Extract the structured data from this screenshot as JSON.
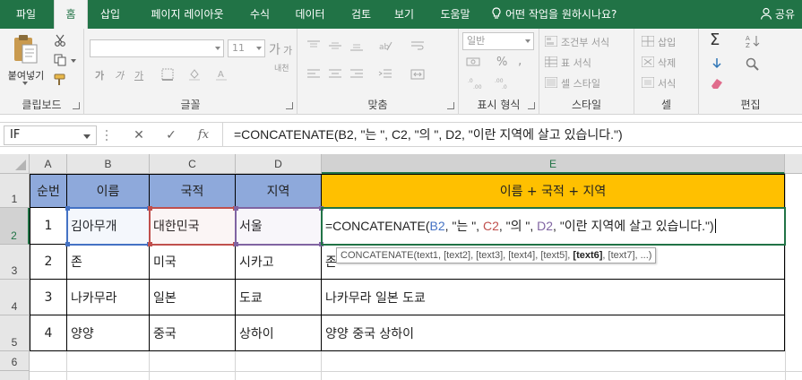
{
  "ribbon_tabs": [
    {
      "label": "파일",
      "active": false
    },
    {
      "label": "홈",
      "active": true
    },
    {
      "label": "삽입",
      "active": false
    },
    {
      "label": "페이지 레이아웃",
      "active": false
    },
    {
      "label": "수식",
      "active": false
    },
    {
      "label": "데이터",
      "active": false
    },
    {
      "label": "검토",
      "active": false
    },
    {
      "label": "보기",
      "active": false
    },
    {
      "label": "도움말",
      "active": false
    }
  ],
  "tell_me": "어떤 작업을 원하시나요?",
  "share_label": "공유",
  "ribbon": {
    "clipboard": {
      "label": "클립보드",
      "paste": "붙여넣기"
    },
    "font": {
      "label": "글꼴",
      "font_name": "",
      "font_size": "11",
      "grow": "가",
      "shrink": "가",
      "bold": "가",
      "italic": "가",
      "underline": "가",
      "phonetic": "내천"
    },
    "alignment": {
      "label": "맞춤"
    },
    "number": {
      "label": "표시 형식",
      "format": "일반",
      "percent": "%",
      "comma": ","
    },
    "styles": {
      "label": "스타일",
      "conditional": "조건부 서식",
      "table": "표 서식",
      "cell_styles": "셀 스타일"
    },
    "cells": {
      "label": "셀",
      "insert": "삽입",
      "delete": "삭제",
      "format": "서식"
    },
    "editing": {
      "label": "편집"
    }
  },
  "formula_bar": {
    "name_box": "IF",
    "cancel": "✕",
    "enter": "✓",
    "fx": "fx",
    "formula": "=CONCATENATE(B2, \"는 \", C2, \"의 \", D2, \"이란 지역에 살고 있습니다.\")"
  },
  "columns": [
    "A",
    "B",
    "C",
    "D",
    "E"
  ],
  "rows": [
    "1",
    "2",
    "3",
    "4",
    "5",
    "6"
  ],
  "sheet": {
    "header": {
      "a": "순번",
      "b": "이름",
      "c": "국적",
      "d": "지역",
      "e": "이름 + 국적 + 지역"
    },
    "data": [
      {
        "a": "1",
        "b": "김아무개",
        "c": "대한민국",
        "d": "서울",
        "e": ""
      },
      {
        "a": "2",
        "b": "존",
        "c": "미국",
        "d": "시카고",
        "e": "존"
      },
      {
        "a": "3",
        "b": "나카무라",
        "c": "일본",
        "d": "도쿄",
        "e": "나카무라 일본 도쿄"
      },
      {
        "a": "4",
        "b": "양양",
        "c": "중국",
        "d": "상하이",
        "e": "양양 중국 상하이"
      }
    ]
  },
  "edit": {
    "p1": "=CONCATENATE(",
    "r1": "B2",
    "p2": ", \"는 \", ",
    "r2": "C2",
    "p3": ", \"의 \", ",
    "r3": "D2",
    "p4": ", \"이란 지역에 살고 있습니다.\")"
  },
  "tooltip": {
    "pre": "CONCATENATE(text1, [text2], [text3], [text4], [text5], ",
    "bold": "[text6]",
    "post": ", [text7], ...)"
  },
  "colors": {
    "excel_green": "#217346",
    "header_blue": "#8ea9db",
    "header_gold": "#ffc000",
    "ref_b": "#4472c4",
    "ref_c": "#c0504d",
    "ref_d": "#8064a2"
  }
}
